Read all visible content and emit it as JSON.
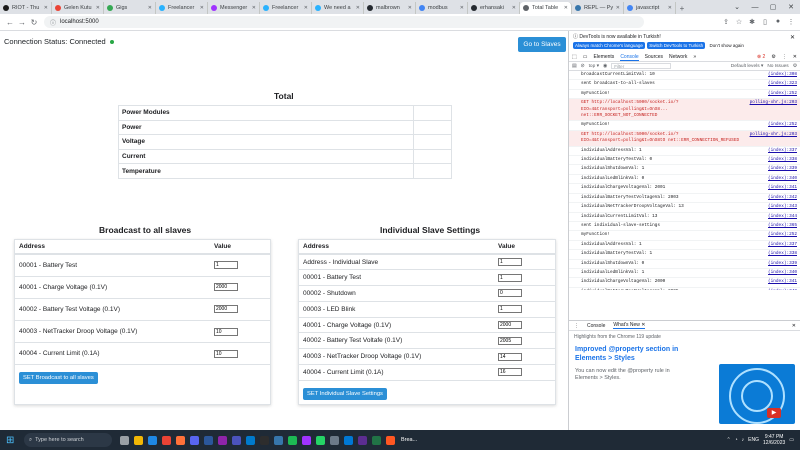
{
  "browser": {
    "tabs": [
      {
        "label": "RIOT - Thu",
        "color": "#1a1a1a"
      },
      {
        "label": "Gelen Kutu",
        "color": "#ea4335"
      },
      {
        "label": "Gigs",
        "color": "#34a853"
      },
      {
        "label": "Freelancer",
        "color": "#29b2fe"
      },
      {
        "label": "Messenger",
        "color": "#a033ff"
      },
      {
        "label": "Freelancer",
        "color": "#29b2fe"
      },
      {
        "label": "We need a",
        "color": "#29b2fe"
      },
      {
        "label": "malbrown",
        "color": "#24292f"
      },
      {
        "label": "modbus",
        "color": "#4285f4"
      },
      {
        "label": "erhansaki",
        "color": "#24292f"
      },
      {
        "label": "Total Table",
        "color": "#5f6368",
        "active": true
      },
      {
        "label": "REPL — Py",
        "color": "#3776ab"
      },
      {
        "label": "javascript",
        "color": "#4285f4"
      }
    ],
    "new_tab_glyph": "+",
    "url": "localhost:5000"
  },
  "page": {
    "status_label": "Connection Status: Connected",
    "goto_slaves": "Go to Slaves",
    "total_title": "Total",
    "total_rows": [
      {
        "label": "Power Modules",
        "value": ""
      },
      {
        "label": "Power",
        "value": ""
      },
      {
        "label": "Voltage",
        "value": ""
      },
      {
        "label": "Current",
        "value": ""
      },
      {
        "label": "Temperature",
        "value": ""
      }
    ],
    "broadcast": {
      "title": "Broadcast to all slaves",
      "col_address": "Address",
      "col_value": "Value",
      "rows": [
        {
          "label": "00001 - Battery Test",
          "value": "1"
        },
        {
          "label": "40001 - Charge Voltage (0.1V)",
          "value": "2000"
        },
        {
          "label": "40002 - Battery Test Voltage (0.1V)",
          "value": "2000"
        },
        {
          "label": "40003 - NetTracker Droop Voltage (0.1V)",
          "value": "10"
        },
        {
          "label": "40004 - Current Limit (0.1A)",
          "value": "10"
        }
      ],
      "button": "SET Broadcast to all slaves"
    },
    "individual": {
      "title": "Individual Slave Settings",
      "col_address": "Address",
      "col_value": "Value",
      "rows": [
        {
          "label": "Address - Individual Slave",
          "value": "1"
        },
        {
          "label": "00001 - Battery Test",
          "value": "1"
        },
        {
          "label": "00002 - Shutdown",
          "value": "0"
        },
        {
          "label": "00003 - LED Blink",
          "value": "1"
        },
        {
          "label": "40001 - Charge Voltage (0.1V)",
          "value": "2000"
        },
        {
          "label": "40002 - Battery Test Voltafe (0.1V)",
          "value": "2005"
        },
        {
          "label": "40003 - NetTracker Droop Voltage (0.1V)",
          "value": "14"
        },
        {
          "label": "40004 - Current Limit (0.1A)",
          "value": "16"
        }
      ],
      "button": "SET Individual Slave Settings"
    }
  },
  "devtools": {
    "info": "DevTools is now available in Turkish!",
    "btn_always": "Always match Chrome's language",
    "btn_switch": "Switch DevTools to Turkish",
    "btn_dont": "Don't show again",
    "tabs": [
      "Elements",
      "Console",
      "Sources",
      "Network",
      "»"
    ],
    "error_count": "2",
    "top_label": "top",
    "filter_placeholder": "Filter",
    "levels": "Default levels",
    "issues": "No Issues",
    "log": [
      {
        "msg": "broadcastCurrentLimitVal: 10",
        "src": "(index):308"
      },
      {
        "msg": "sent broadcast-to-all-slaves",
        "src": "(index):323"
      },
      {
        "msg": "myFunction!",
        "src": "(index):252"
      },
      {
        "msg": "GET http://localhost:5000/socket.io/?EIO=4&transport=polling&t=OnS8... net::ERR_SOCKET_NOT_CONNECTED",
        "src": "polling-xhr.js:203",
        "err": true
      },
      {
        "msg": "myFunction!",
        "src": "(index):252"
      },
      {
        "msg": "GET http://localhost:5000/socket.io/?EIO=4&transport=polling&t=OnS8tO net::ERR_CONNECTION_REFUSED",
        "src": "polling-xhr.js:203",
        "err": true
      },
      {
        "msg": "individualAddressVal: 1",
        "src": "(index):337"
      },
      {
        "msg": "individualBatteryTestVal: 0",
        "src": "(index):338"
      },
      {
        "msg": "individualShutdownVal: 1",
        "src": "(index):339"
      },
      {
        "msg": "individualLedBlinkVal: 0",
        "src": "(index):340"
      },
      {
        "msg": "individualChargeVoltageVal: 2001",
        "src": "(index):341"
      },
      {
        "msg": "individualBatteryTestVoltageVal: 2003",
        "src": "(index):342"
      },
      {
        "msg": "individualNetTrackerDroopVoltageVal: 13",
        "src": "(index):343"
      },
      {
        "msg": "individualCurrentLimitVal: 13",
        "src": "(index):344"
      },
      {
        "msg": "sent individual-slave-settings",
        "src": "(index):365"
      },
      {
        "msg": "myFunction!",
        "src": "(index):252"
      },
      {
        "msg": "individualAddressVal: 1",
        "src": "(index):337"
      },
      {
        "msg": "individualBatteryTestVal: 1",
        "src": "(index):338"
      },
      {
        "msg": "individualShutdownVal: 0",
        "src": "(index):339"
      },
      {
        "msg": "individualLedBlinkVal: 1",
        "src": "(index):340"
      },
      {
        "msg": "individualChargeVoltageVal: 2000",
        "src": "(index):341"
      },
      {
        "msg": "individualBatteryTestVoltageVal: 2005",
        "src": "(index):342"
      },
      {
        "msg": "individualNetTrackerDroopVoltageVal: 14",
        "src": "(index):343"
      },
      {
        "msg": "individualCurrentLimitVal: 16",
        "src": "(index):344"
      },
      {
        "msg": "sent individual-slave-settings",
        "src": "(index):365"
      }
    ],
    "drawer_tabs": [
      "Console",
      "What's New"
    ],
    "highlights": "Highlights from the Chrome 119 update",
    "whatsnew_title": "Improved @property section in Elements > Styles",
    "whatsnew_text": "You can now edit the @property rule in Elements > Styles."
  },
  "taskbar": {
    "search_placeholder": "Type here to search",
    "active_app": "Brea...",
    "lang": "ENG",
    "time": "9:47 PM",
    "date": "12/6/2023"
  }
}
